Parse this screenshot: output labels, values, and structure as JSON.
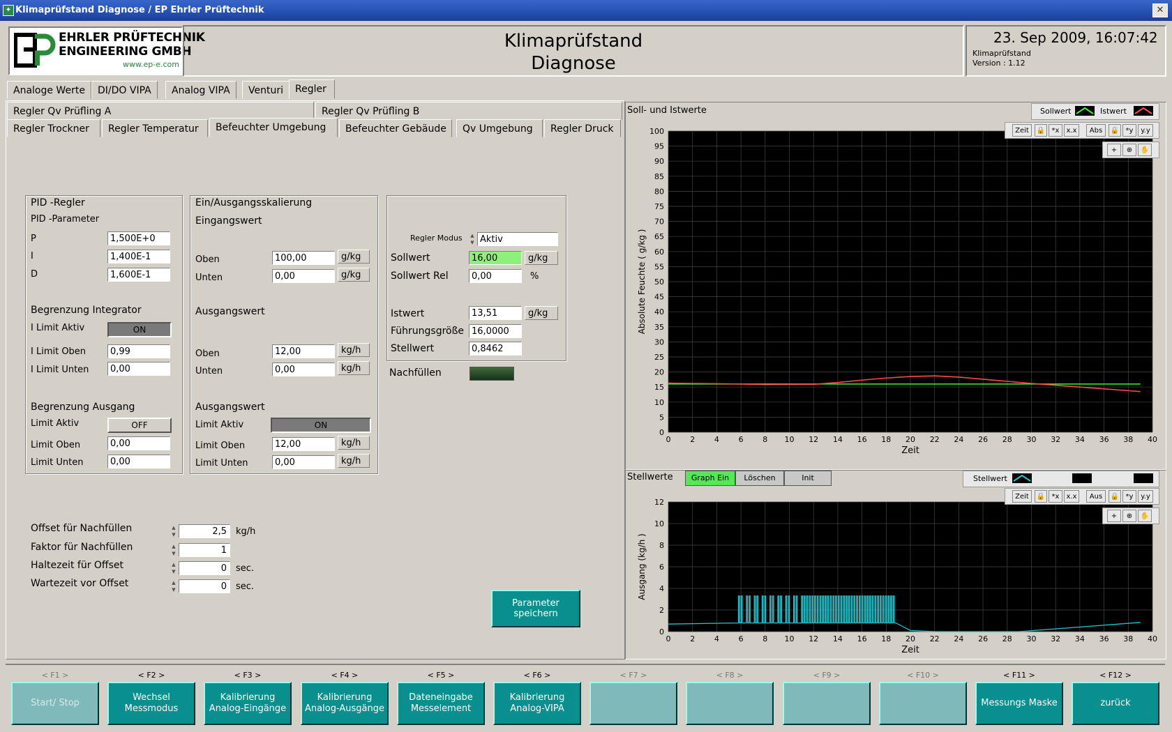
{
  "window": {
    "title": "Klimaprüfstand Diagnose / EP Ehrler Prüftechnik"
  },
  "logo": {
    "ep": "EP",
    "line1": "EHRLER PRÜFTECHNIK",
    "line2": "ENGINEERING GMBH",
    "url": "www.ep-e.com"
  },
  "header": {
    "title1": "Klimaprüfstand",
    "title2": "Diagnose",
    "datetime": "23. Sep 2009, 16:07:42",
    "app": "Klimaprüfstand",
    "version": "Version : 1.12"
  },
  "main_tabs": [
    {
      "label": "Analoge Werte"
    },
    {
      "label": "DI/DO VIPA"
    },
    {
      "label": "Analog VIPA"
    },
    {
      "label": "Venturi"
    },
    {
      "label": "Regler"
    }
  ],
  "sub_tabs_row1": [
    {
      "label": "Regler Qv Prüfling A"
    },
    {
      "label": "Regler Qv Prüfling B"
    }
  ],
  "sub_tabs_row2": [
    {
      "label": "Regler Trockner"
    },
    {
      "label": "Regler Temperatur"
    },
    {
      "label": "Befeuchter Umgebung"
    },
    {
      "label": "Befeuchter Gebäude"
    },
    {
      "label": "Qv Umgebung"
    },
    {
      "label": "Regler Druck"
    }
  ],
  "pid": {
    "title": "PID -Regler",
    "subtitle": "PID -Parameter",
    "p_label": "P",
    "p_value": "1,500E+0",
    "i_label": "I",
    "i_value": "1,400E-1",
    "d_label": "D",
    "d_value": "1,600E-1",
    "int_title": "Begrenzung Integrator",
    "ilimit_aktiv_label": "I Limit Aktiv",
    "ilimit_aktiv_value": "ON",
    "ilimit_oben_label": "I Limit Oben",
    "ilimit_oben_value": "0,99",
    "ilimit_unten_label": "I Limit Unten",
    "ilimit_unten_value": "0,00",
    "out_title": "Begrenzung Ausgang",
    "limit_aktiv_label": "Limit Aktiv",
    "limit_aktiv_value": "OFF",
    "limit_oben_label": "Limit Oben",
    "limit_oben_value": "0,00",
    "limit_unten_label": "Limit Unten",
    "limit_unten_value": "0,00"
  },
  "scaling": {
    "title": "Ein/Ausgangsskalierung",
    "in_title": "Eingangswert",
    "in_oben_label": "Oben",
    "in_oben_value": "100,00",
    "in_oben_unit": "g/kg",
    "in_unten_label": "Unten",
    "in_unten_value": "0,00",
    "in_unten_unit": "g/kg",
    "out_title": "Ausgangswert",
    "out_oben_label": "Oben",
    "out_oben_value": "12,00",
    "out_oben_unit": "kg/h",
    "out_unten_label": "Unten",
    "out_unten_value": "0,00",
    "out_unten_unit": "kg/h",
    "lim_title": "Ausgangswert",
    "lim_aktiv_label": "Limit Aktiv",
    "lim_aktiv_value": "ON",
    "lim_oben_label": "Limit Oben",
    "lim_oben_value": "12,00",
    "lim_oben_unit": "kg/h",
    "lim_unten_label": "Limit Unten",
    "lim_unten_value": "0,00",
    "lim_unten_unit": "kg/h"
  },
  "regler": {
    "modus_label": "Regler Modus",
    "modus_value": "Aktiv",
    "sollwert_label": "Sollwert",
    "sollwert_value": "16,00",
    "sollwert_unit": "g/kg",
    "sollwert_rel_label": "Sollwert  Rel",
    "sollwert_rel_value": "0,00",
    "sollwert_rel_unit": "%",
    "istwert_label": "Istwert",
    "istwert_value": "13,51",
    "istwert_unit": "g/kg",
    "fuehrung_label": "Führungsgröße",
    "fuehrung_value": "16,0000",
    "stellwert_label": "Stellwert",
    "stellwert_value": "0,8462",
    "nachfuellen_label": "Nachfüllen"
  },
  "offsets": {
    "offset_label": "Offset für Nachfüllen",
    "offset_value": "2,5",
    "offset_unit": "kg/h",
    "faktor_label": "Faktor für Nachfüllen",
    "faktor_value": "1",
    "haltezeit_label": "Haltezeit für Offset",
    "haltezeit_value": "0",
    "haltezeit_unit": "sec.",
    "wartezeit_label": "Wartezeit vor Offset",
    "wartezeit_value": "0",
    "wartezeit_unit": "sec."
  },
  "save_button": "Parameter speichern",
  "colors": {
    "sollwert": "#44ee33",
    "istwert": "#ff4a4a",
    "stellwert": "#22c6cf",
    "accent": "#0a8f8f",
    "plot_bg": "#000000"
  },
  "chart1": {
    "title": "Soll- und Istwerte",
    "legend_soll": "Sollwert",
    "legend_ist": "Istwert",
    "toolbar": {
      "zeit": "Zeit",
      "abs": "Abs"
    }
  },
  "chart2": {
    "title": "Stellwerte",
    "btn_graph": "Graph Ein",
    "btn_loeschen": "Löschen",
    "btn_init": "Init",
    "legend": "Stellwert",
    "toolbar": {
      "zeit": "Zeit",
      "aus": "Aus"
    }
  },
  "chart_data": [
    {
      "type": "line",
      "title": "Soll- und Istwerte",
      "xlabel": "Zeit",
      "ylabel": "Absolute Feuchte ( g/kg )",
      "xlim": [
        0,
        40
      ],
      "ylim": [
        0,
        100
      ],
      "xticks": [
        0,
        2,
        4,
        6,
        8,
        10,
        12,
        14,
        16,
        18,
        20,
        22,
        24,
        26,
        28,
        30,
        32,
        34,
        36,
        38,
        40
      ],
      "yticks": [
        0,
        5,
        10,
        15,
        20,
        25,
        30,
        35,
        40,
        45,
        50,
        55,
        60,
        65,
        70,
        75,
        80,
        85,
        90,
        95,
        100
      ],
      "grid": true,
      "series": [
        {
          "name": "Sollwert",
          "x": [
            0,
            39
          ],
          "y": [
            16,
            16
          ]
        },
        {
          "name": "Istwert",
          "x": [
            0,
            2,
            6,
            8,
            12,
            14,
            16,
            18,
            20,
            22,
            24,
            26,
            28,
            30,
            32,
            34,
            36,
            38,
            39
          ],
          "y": [
            16.3,
            16.2,
            16,
            15.8,
            15.9,
            16.5,
            17.3,
            18,
            18.5,
            18.7,
            18.3,
            17.6,
            16.9,
            16.2,
            15.6,
            15,
            14.4,
            13.8,
            13.5
          ]
        }
      ]
    },
    {
      "type": "line",
      "title": "Stellwerte",
      "xlabel": "Zeit",
      "ylabel": "Ausgang (kg/h )",
      "xlim": [
        0,
        40
      ],
      "ylim": [
        0,
        12
      ],
      "xticks": [
        0,
        2,
        4,
        6,
        8,
        10,
        12,
        14,
        16,
        18,
        20,
        22,
        24,
        26,
        28,
        30,
        32,
        34,
        36,
        38,
        40
      ],
      "yticks": [
        0,
        2,
        4,
        6,
        8,
        10,
        12
      ],
      "grid": true,
      "series": [
        {
          "name": "Stellwert",
          "baseline_x": [
            0,
            5.8,
            18.8,
            20,
            22,
            29,
            39
          ],
          "baseline_y": [
            0.7,
            0.8,
            0.8,
            0.1,
            0,
            0,
            0.85
          ],
          "pulse_range": [
            5.8,
            18.8
          ],
          "pulse_high": 3.3,
          "pulse_low": 0.8
        }
      ]
    }
  ],
  "fkeys": [
    {
      "key": "< F1 >",
      "label": "Start/ Stop",
      "enabled": false
    },
    {
      "key": "< F2 >",
      "label": "Wechsel Messmodus",
      "enabled": true
    },
    {
      "key": "< F3 >",
      "label": "Kalibrierung Analog-Eingänge",
      "enabled": true
    },
    {
      "key": "< F4 >",
      "label": "Kalibrierung Analog-Ausgänge",
      "enabled": true
    },
    {
      "key": "< F5 >",
      "label": "Dateneingabe Messelement",
      "enabled": true
    },
    {
      "key": "< F6 >",
      "label": "Kalibrierung Analog-VIPA",
      "enabled": true
    },
    {
      "key": "< F7 >",
      "label": "",
      "enabled": false
    },
    {
      "key": "< F8 >",
      "label": "",
      "enabled": false
    },
    {
      "key": "< F9 >",
      "label": "",
      "enabled": false
    },
    {
      "key": "< F10 >",
      "label": "",
      "enabled": false
    },
    {
      "key": "< F11 >",
      "label": "Messungs Maske",
      "enabled": true
    },
    {
      "key": "< F12 >",
      "label": "zurück",
      "enabled": true
    }
  ]
}
